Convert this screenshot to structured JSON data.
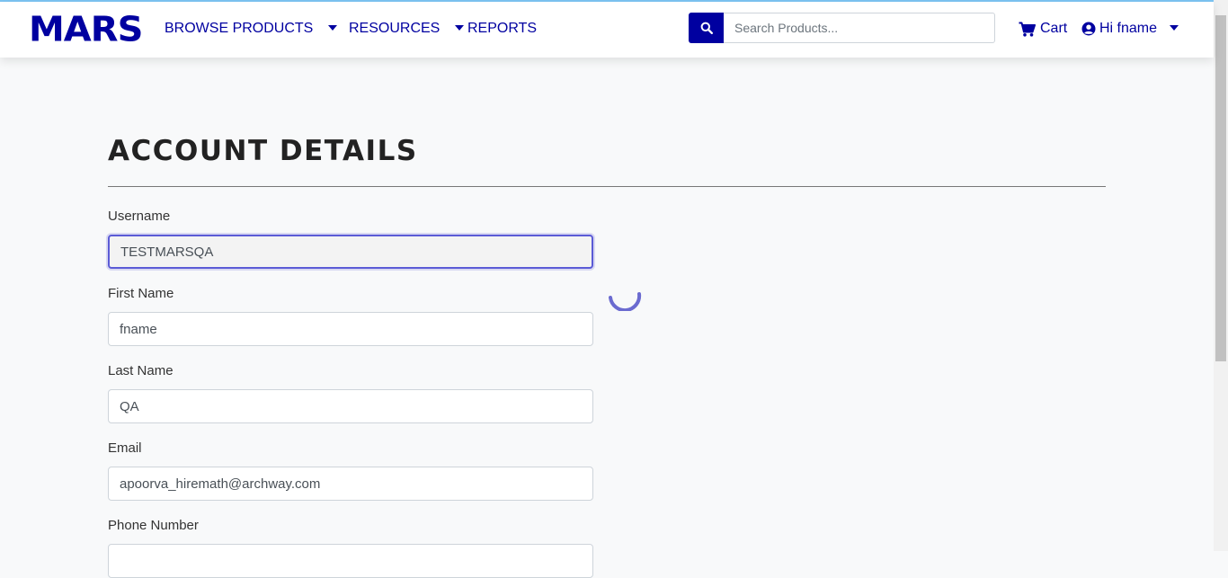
{
  "brand": {
    "logo_text": "MARS",
    "color": "#0000a0"
  },
  "nav": {
    "items": [
      {
        "label": "BROWSE PRODUCTS",
        "has_dropdown": true
      },
      {
        "label": "RESOURCES",
        "has_dropdown": true
      },
      {
        "label": "REPORTS",
        "has_dropdown": false
      }
    ]
  },
  "search": {
    "placeholder": "Search Products...",
    "icon": "search-icon"
  },
  "header_actions": {
    "cart_label": "Cart",
    "cart_icon": "cart-icon",
    "user_label": "Hi fname",
    "user_icon": "user-circle-icon"
  },
  "page": {
    "title": "ACCOUNT DETAILS",
    "loading": true
  },
  "form": {
    "username": {
      "label": "Username",
      "value": "TESTMARSQA"
    },
    "first_name": {
      "label": "First Name",
      "value": "fname"
    },
    "last_name": {
      "label": "Last Name",
      "value": "QA"
    },
    "email": {
      "label": "Email",
      "value": "apoorva_hiremath@archway.com"
    },
    "phone": {
      "label": "Phone Number",
      "value": ""
    }
  }
}
